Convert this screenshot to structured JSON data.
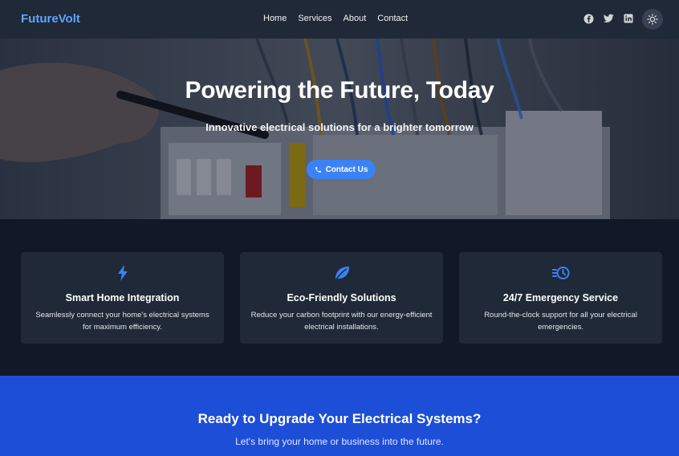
{
  "nav": {
    "brand": "FutureVolt",
    "links": [
      "Home",
      "Services",
      "About",
      "Contact"
    ],
    "social_icons": [
      "facebook-icon",
      "twitter-icon",
      "linkedin-icon"
    ],
    "theme_icon": "sun-icon"
  },
  "hero": {
    "title": "Powering the Future, Today",
    "subtitle": "Innovative electrical solutions for a brighter tomorrow",
    "cta_label": "Contact Us",
    "cta_icon": "phone-icon"
  },
  "features": [
    {
      "icon": "bolt-icon",
      "title": "Smart Home Integration",
      "desc": "Seamlessly connect your home's electrical systems for maximum efficiency."
    },
    {
      "icon": "leaf-icon",
      "title": "Eco-Friendly Solutions",
      "desc": "Reduce your carbon footprint with our energy-efficient electrical installations."
    },
    {
      "icon": "clock-icon",
      "title": "24/7 Emergency Service",
      "desc": "Round-the-clock support for all your electrical emergencies."
    }
  ],
  "cta_section": {
    "title": "Ready to Upgrade Your Electrical Systems?",
    "subtitle": "Let's bring your home or business into the future."
  },
  "colors": {
    "accent": "#3b82f6",
    "brand": "#60a5fa",
    "nav_bg": "#1f2937",
    "page_bg": "#111827",
    "card_bg": "#1f2937",
    "cta_bg": "#1d4ed8"
  }
}
